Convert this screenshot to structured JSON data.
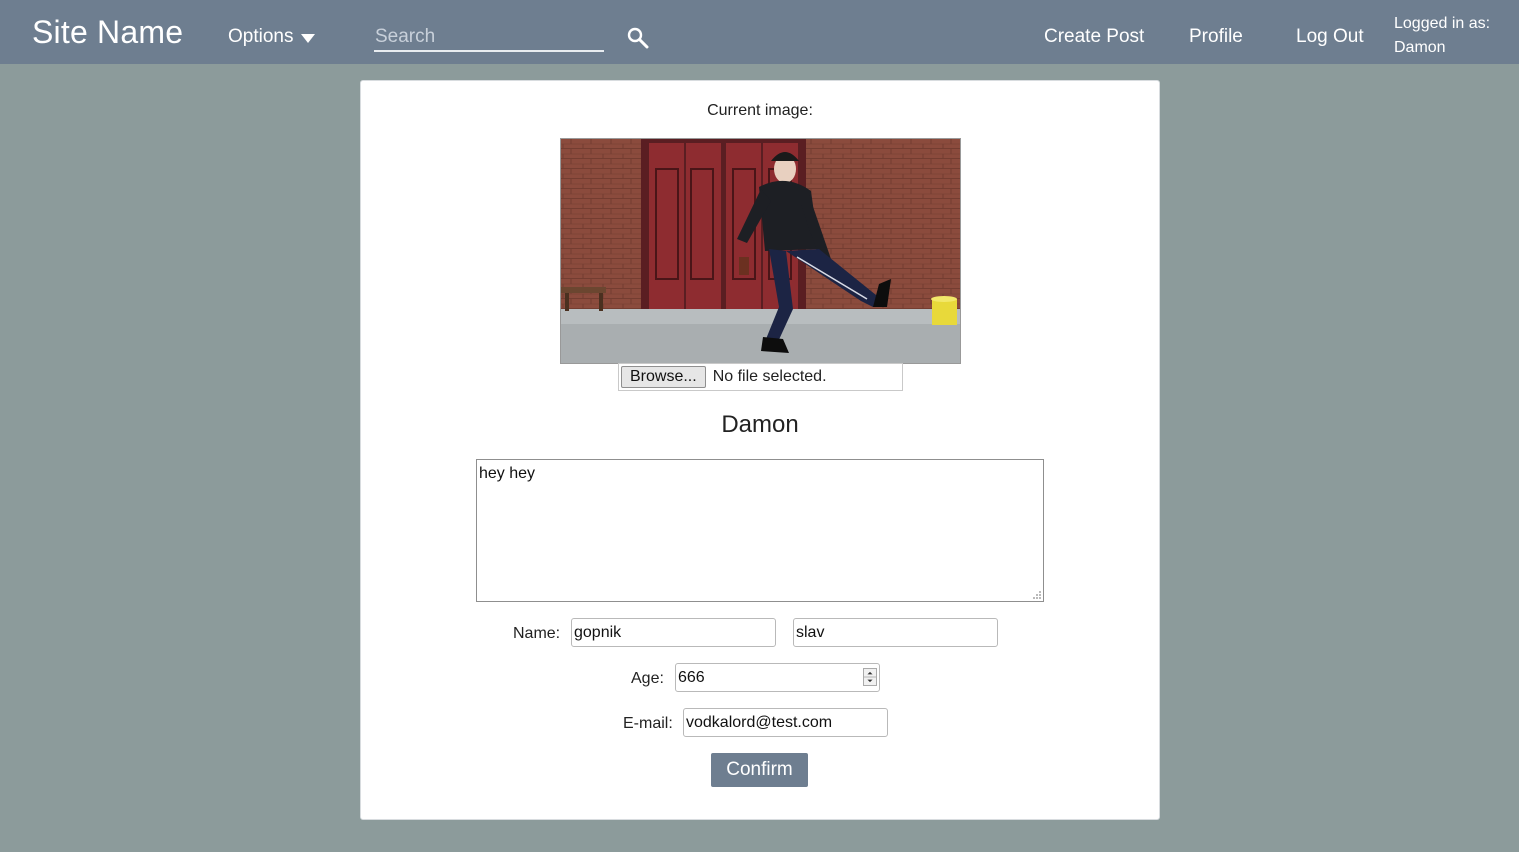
{
  "navbar": {
    "site_name": "Site Name",
    "options_label": "Options",
    "search_placeholder": "Search",
    "links": {
      "create_post": "Create Post",
      "profile": "Profile",
      "log_out": "Log Out"
    },
    "logged_in_label": "Logged in as:",
    "logged_in_user": "Damon"
  },
  "profile_form": {
    "current_image_label": "Current image:",
    "browse_label": "Browse...",
    "file_status": "No file selected.",
    "display_name": "Damon",
    "bio": "hey hey",
    "name_label": "Name:",
    "first_name": "gopnik",
    "last_name": "slav",
    "age_label": "Age:",
    "age": "666",
    "email_label": "E-mail:",
    "email": "vodkalord@test.com",
    "confirm_label": "Confirm"
  },
  "colors": {
    "navbar_bg": "#6e7e90",
    "page_bg": "#8c9b9b",
    "button_bg": "#6e7e90"
  },
  "icons": {
    "search": "search-icon",
    "dropdown": "caret-down-icon"
  }
}
